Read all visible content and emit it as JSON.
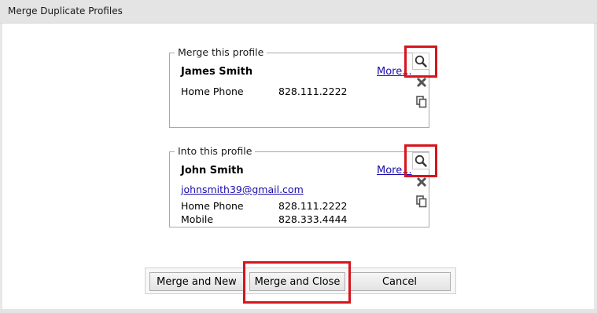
{
  "window": {
    "title": "Merge Duplicate Profiles"
  },
  "source_profile": {
    "legend": "Merge this profile",
    "name": "James Smith",
    "more_link": "More...",
    "fields": [
      {
        "label": "Home Phone",
        "value": "828.111.2222"
      }
    ]
  },
  "target_profile": {
    "legend": "Into this profile",
    "name": "John Smith",
    "more_link": "More...",
    "email": "johnsmith39@gmail.com",
    "fields": [
      {
        "label": "Home Phone",
        "value": "828.111.2222"
      },
      {
        "label": "Mobile",
        "value": "828.333.4444"
      }
    ]
  },
  "buttons": {
    "merge_and_new": "Merge and New",
    "merge_and_close": "Merge and Close",
    "cancel": "Cancel"
  },
  "icons": {
    "view": "search-icon",
    "remove": "close-icon",
    "copy": "copy-icon"
  },
  "colors": {
    "highlight": "#d6151c",
    "link": "#1a0dab"
  }
}
